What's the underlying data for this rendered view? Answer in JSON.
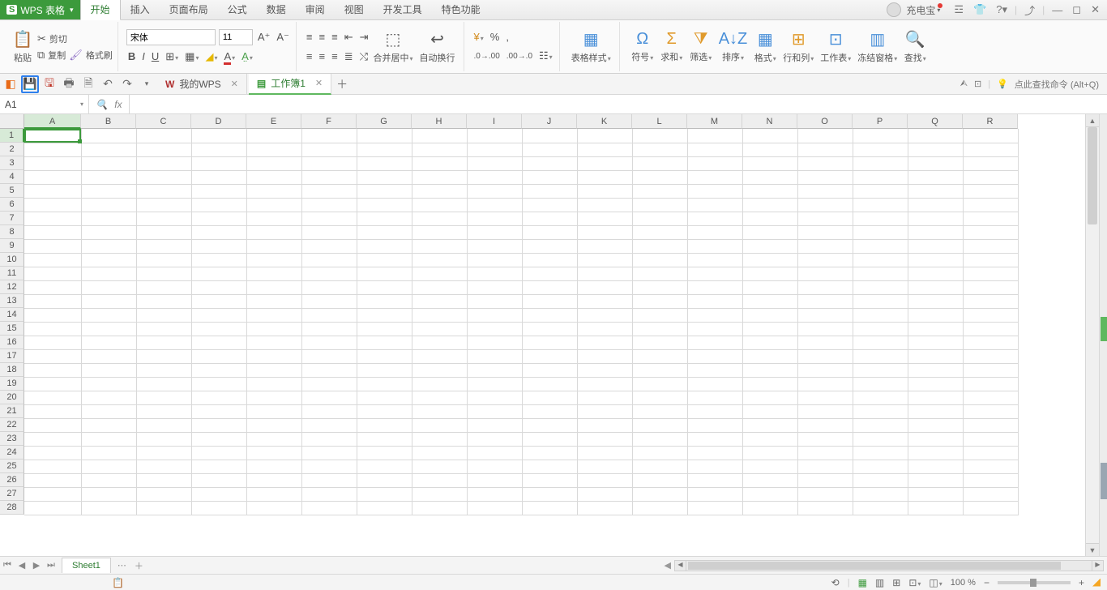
{
  "app": {
    "name": "WPS 表格"
  },
  "menu": {
    "tabs": [
      "开始",
      "插入",
      "页面布局",
      "公式",
      "数据",
      "审阅",
      "视图",
      "开发工具",
      "特色功能"
    ],
    "activeIndex": 0
  },
  "user": {
    "name": "充电宝"
  },
  "ribbon": {
    "paste": "粘贴",
    "cut": "剪切",
    "copy": "复制",
    "formatPainter": "格式刷",
    "fontName": "宋体",
    "fontSize": "11",
    "mergeCenter": "合并居中",
    "wrapText": "自动换行",
    "tableStyle": "表格样式",
    "symbol": "符号",
    "sum": "求和",
    "filter": "筛选",
    "sort": "排序",
    "format": "格式",
    "rowsCols": "行和列",
    "worksheet": "工作表",
    "freezePanes": "冻结窗格",
    "find": "查找",
    "percent": "%",
    "comma": ",",
    "decInc": ".00",
    "decDec": ".0"
  },
  "qa": {
    "hint": "点此查找命令 (Alt+Q)"
  },
  "doctabs": {
    "items": [
      {
        "label": "我的WPS",
        "icon": "W"
      },
      {
        "label": "工作簿1",
        "icon": "S"
      }
    ],
    "activeIndex": 1
  },
  "namebox": {
    "ref": "A1"
  },
  "grid": {
    "cols": [
      "A",
      "B",
      "C",
      "D",
      "E",
      "F",
      "G",
      "H",
      "I",
      "J",
      "K",
      "L",
      "M",
      "N",
      "O",
      "P",
      "Q",
      "R"
    ],
    "rows": 28
  },
  "sheets": {
    "active": "Sheet1"
  },
  "status": {
    "zoom": "100 %"
  }
}
